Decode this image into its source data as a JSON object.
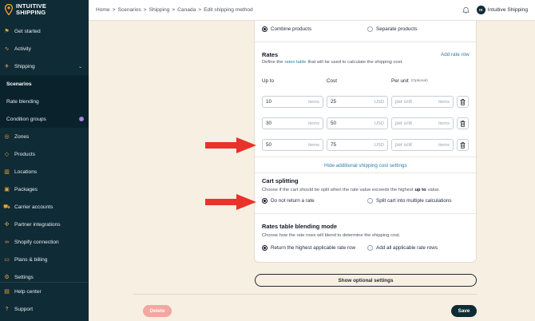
{
  "brand": {
    "line1": "INTUITIVE",
    "line2": "SHIPPING"
  },
  "sidebar": {
    "items": [
      {
        "label": "Get started",
        "icon": "flag-icon"
      },
      {
        "label": "Activity",
        "icon": "activity-icon"
      },
      {
        "label": "Shipping",
        "icon": "megaphone-icon"
      },
      {
        "label": "Scenarios"
      },
      {
        "label": "Rate blending"
      },
      {
        "label": "Condition groups",
        "badge": "!"
      },
      {
        "label": "Zones",
        "icon": "globe-icon"
      },
      {
        "label": "Products",
        "icon": "tag-icon"
      },
      {
        "label": "Locations",
        "icon": "building-icon"
      },
      {
        "label": "Packages",
        "icon": "box-icon"
      },
      {
        "label": "Carrier accounts",
        "icon": "truck-icon"
      },
      {
        "label": "Partner integrations",
        "icon": "puzzle-icon"
      },
      {
        "label": "Shopify connection",
        "icon": "link-icon"
      },
      {
        "label": "Plans & billing",
        "icon": "card-icon"
      },
      {
        "label": "Settings",
        "icon": "gear-icon"
      }
    ],
    "bottom": [
      {
        "label": "Help center",
        "icon": "book-icon"
      },
      {
        "label": "Support",
        "icon": "help-icon"
      }
    ]
  },
  "topbar": {
    "breadcrumb": [
      "Home",
      ">",
      "Scenarios",
      ">",
      "Shipping",
      ">",
      "Canada",
      ">",
      "Edit shipping method"
    ],
    "avatar_initials": "IS",
    "account_name": "Intuitive Shipping"
  },
  "combine": {
    "option1": "Combine products",
    "option2": "Separate products"
  },
  "rates": {
    "title": "Rates",
    "add_link": "Add rate row",
    "desc_pre": "Define the",
    "desc_link": "rates table",
    "desc_post": "that will be used to calculate the shipping cost.",
    "col_upto": "Up to",
    "col_cost": "Cost",
    "col_perunit": "Per unit",
    "col_optional": "(Optional)",
    "rows": [
      {
        "upto": "10",
        "upto_unit": "items",
        "cost": "25",
        "currency": "USD",
        "perunit_placeholder": "per unit",
        "perunit_unit": "items"
      },
      {
        "upto": "30",
        "upto_unit": "items",
        "cost": "50",
        "currency": "USD",
        "perunit_placeholder": "per unit",
        "perunit_unit": "items"
      },
      {
        "upto": "50",
        "upto_unit": "items",
        "cost": "75",
        "currency": "USD",
        "perunit_placeholder": "per unit",
        "perunit_unit": "items"
      }
    ],
    "hide_link": "Hide additional shipping cost settings"
  },
  "cart": {
    "title": "Cart splitting",
    "desc_pre": "Choose if the cart should be split when the rate value exceeds the highest",
    "desc_bold": "up to",
    "desc_post": "value.",
    "option1": "Do not return a rate",
    "option2": "Split cart into multiple calculations"
  },
  "blend": {
    "title": "Rates table blending mode",
    "desc": "Choose how the rate rows will blend to determine the shipping cost.",
    "option1": "Return the highest applicable rate row",
    "option2": "Add all applicable rate rows"
  },
  "buttons": {
    "optional": "Show optional settings",
    "delete": "Delete",
    "save": "Save"
  },
  "colors": {
    "sidebar": "#0f2b36",
    "page": "#f6efe2",
    "accent": "#f0a43a",
    "link": "#2a7fa7",
    "arrow": "#e8322a",
    "delete": "#f4a6a0"
  }
}
